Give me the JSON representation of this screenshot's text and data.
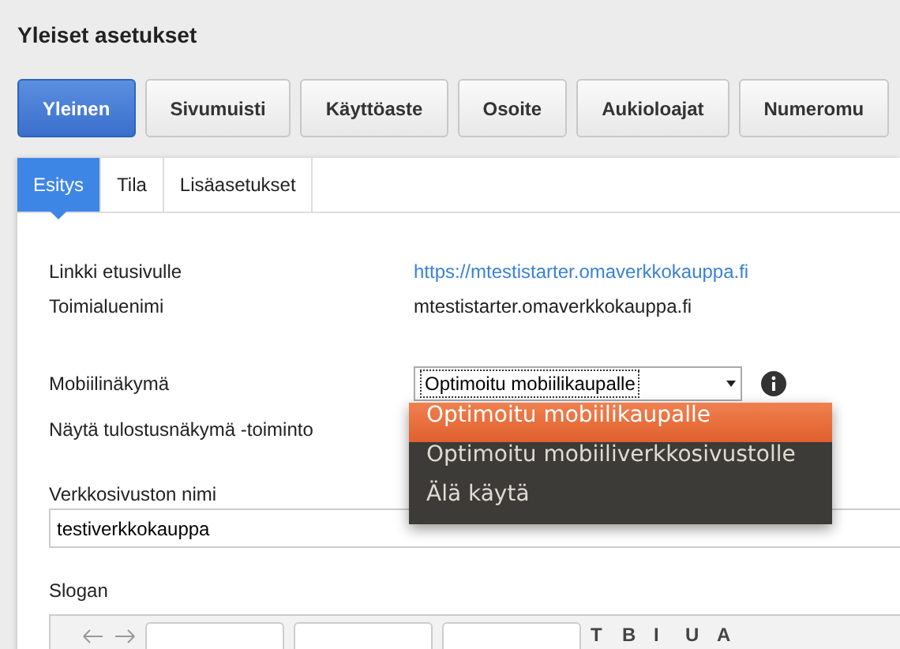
{
  "page_title": "Yleiset asetukset",
  "sections": [
    {
      "label": "Yleinen",
      "selected": true
    },
    {
      "label": "Sivumuisti",
      "selected": false
    },
    {
      "label": "Käyttöaste",
      "selected": false
    },
    {
      "label": "Osoite",
      "selected": false
    },
    {
      "label": "Aukioloajat",
      "selected": false
    },
    {
      "label": "Numeromu",
      "selected": false
    }
  ],
  "tabs": [
    {
      "label": "Esitys",
      "selected": true
    },
    {
      "label": "Tila",
      "selected": false
    },
    {
      "label": "Lisäasetukset",
      "selected": false
    }
  ],
  "info_rows": [
    {
      "label": "Linkki etusivulle",
      "value": "https://mtestistarter.omaverkkokauppa.fi",
      "kind": "link"
    },
    {
      "label": "Toimialuenimi",
      "value": "mtestistarter.omaverkkokauppa.fi",
      "kind": "text"
    }
  ],
  "mobile_view": {
    "label": "Mobiilinäkymä",
    "value": "Optimoitu mobiilikaupalle",
    "expanded": true,
    "options": [
      {
        "label": "Optimoitu mobiilikaupalle",
        "selected": true
      },
      {
        "label": "Optimoitu mobiiliverkkosivustolle",
        "selected": false
      },
      {
        "label": "Älä käytä",
        "selected": false
      }
    ]
  },
  "print_view": {
    "label": "Näytä tulostusnäkymä -toiminto"
  },
  "site_name": {
    "label": "Verkkosivuston nimi",
    "value": "testiverkkokauppa"
  },
  "slogan": {
    "label": "Slogan",
    "format_buttons": [
      "T",
      "B",
      "I",
      "U",
      "A"
    ]
  }
}
